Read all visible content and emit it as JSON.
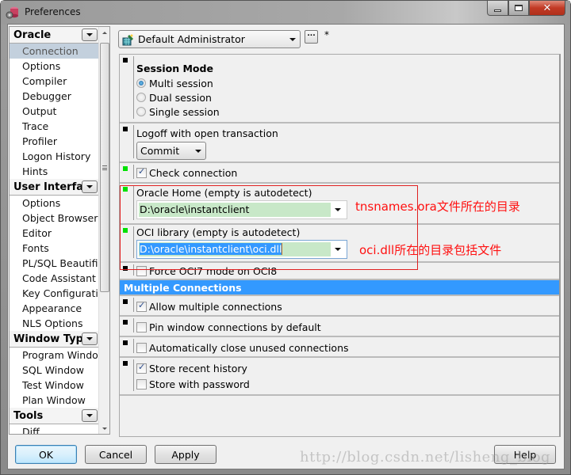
{
  "window": {
    "title": "Preferences",
    "controls": {
      "minimize": "minimize",
      "maximize": "maximize",
      "close": "close"
    }
  },
  "sidebar": {
    "groups": [
      {
        "header": "Oracle",
        "items": [
          "Connection",
          "Options",
          "Compiler",
          "Debugger",
          "Output",
          "Trace",
          "Profiler",
          "Logon History",
          "Hints"
        ],
        "selected": "Connection"
      },
      {
        "header": "User Interface",
        "items": [
          "Options",
          "Object Browser",
          "Editor",
          "Fonts",
          "PL/SQL Beautifier",
          "Code Assistant",
          "Key Configuration",
          "Appearance",
          "NLS Options"
        ]
      },
      {
        "header": "Window Types",
        "items": [
          "Program Window",
          "SQL Window",
          "Test Window",
          "Plan Window"
        ]
      },
      {
        "header": "Tools",
        "items": [
          "Diff"
        ]
      }
    ]
  },
  "profile": {
    "selected": "Default Administrator",
    "more_label": "...",
    "modified_marker": "*"
  },
  "settings": {
    "session_mode": {
      "label": "Session Mode",
      "options": [
        "Multi session",
        "Dual session",
        "Single session"
      ],
      "selected": "Multi session"
    },
    "logoff": {
      "label": "Logoff with open transaction",
      "value": "Commit"
    },
    "check_connection": {
      "label": "Check connection",
      "checked": true
    },
    "oracle_home": {
      "label": "Oracle Home (empty is autodetect)",
      "value": "D:\\oracle\\instantclient"
    },
    "oci_library": {
      "label": "OCI library (empty is autodetect)",
      "value": "D:\\oracle\\instantclient\\oci.dll"
    },
    "force_oci7": {
      "label": "Force OCI7 mode on OCI8",
      "checked": false
    },
    "multiple_connections": {
      "header": "Multiple Connections",
      "allow_multiple": {
        "label": "Allow multiple connections",
        "checked": true
      },
      "pin_window": {
        "label": "Pin window connections by default",
        "checked": false
      },
      "auto_close": {
        "label": "Automatically close unused connections",
        "checked": false
      },
      "store_history": {
        "label": "Store recent history",
        "checked": true
      },
      "store_password": {
        "label": "Store with password",
        "checked": false
      }
    }
  },
  "annotations": {
    "oracle_home_note": "tnsnames.ora文件所在的目录",
    "oci_note": "oci.dll所在的目录包括文件",
    "color": "#ff1010"
  },
  "footer": {
    "ok": "OK",
    "cancel": "Cancel",
    "apply": "Apply",
    "help": "Help"
  },
  "watermark": "http://blog.csdn.net/lisheng_blog",
  "colors": {
    "section_header": "#3399ff",
    "selected_sidebar": "#c3d0dd",
    "path_field_bg": "#c8e8c8",
    "changed_marker": "#00e000"
  }
}
